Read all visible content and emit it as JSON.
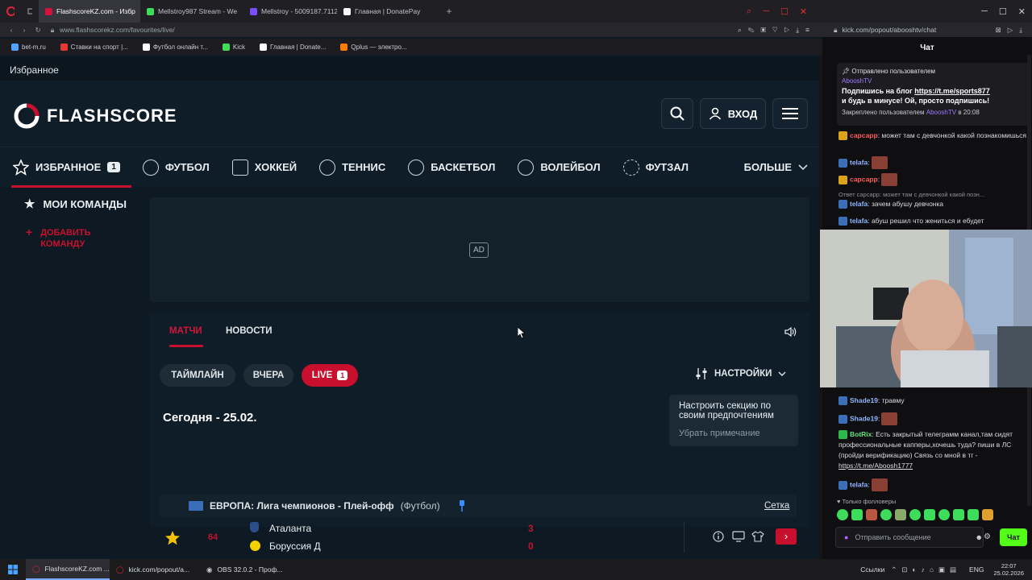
{
  "browser": {
    "tabs": [
      {
        "label": "FlashscoreKZ.com - Избр",
        "active": true,
        "color": "#d4143a"
      },
      {
        "label": "Mellstroy987 Stream - We",
        "active": false,
        "color": "#3ddc5a"
      },
      {
        "label": "Mellstroy - 5009187.7112",
        "active": false,
        "color": "#7c4dff"
      },
      {
        "label": "Главная | DonatePay",
        "active": false,
        "color": "#ffffff"
      }
    ],
    "url": "www.flashscorekz.com/favourites/live/",
    "bookmarks": [
      {
        "label": "bet-m.ru",
        "color": "#4fa3ff"
      },
      {
        "label": "Ставки на спорт |...",
        "color": "#e53935"
      },
      {
        "label": "Футбол онлайн т...",
        "color": "#ffffff"
      },
      {
        "label": "Kick",
        "color": "#3ddc5a"
      },
      {
        "label": "Главная | Donate...",
        "color": "#ffffff"
      },
      {
        "label": "Qplus — электро...",
        "color": "#ff7a00"
      }
    ]
  },
  "flashscore": {
    "favourites_title": "Избранное",
    "logo": "FLASHSCORE",
    "login_label": "ВХОД",
    "nav": [
      {
        "label": "ИЗБРАННОЕ",
        "badge": "1",
        "active": true
      },
      {
        "label": "ФУТБОЛ"
      },
      {
        "label": "ХОККЕЙ"
      },
      {
        "label": "ТЕННИС"
      },
      {
        "label": "БАСКЕТБОЛ"
      },
      {
        "label": "ВОЛЕЙБОЛ"
      },
      {
        "label": "ФУТЗАЛ"
      }
    ],
    "more_label": "БОЛЬШЕ",
    "my_teams": "МОИ КОМАНДЫ",
    "add_team": "ДОБАВИТЬ КОМАНДУ",
    "ad_label": "AD",
    "tabs": {
      "matches": "МАТЧИ",
      "news": "НОВОСТИ"
    },
    "filters": {
      "timeline": "ТАЙМЛАЙН",
      "yesterday": "ВЧЕРА",
      "live": "LIVE",
      "live_count": "1"
    },
    "settings_label": "НАСТРОЙКИ",
    "tooltip": {
      "text": "Настроить секцию по своим предпочтениям",
      "dismiss": "Убрать примечание"
    },
    "date_header": "Сегодня - 25.02.",
    "league": {
      "name": "ЕВРОПА: Лига чемпионов - Плей-офф",
      "sport": "(Футбол)",
      "bracket": "Сетка"
    },
    "match": {
      "minute": "64",
      "home": "Аталанта",
      "away": "Боруссия Д",
      "home_score": "3",
      "away_score": "0"
    }
  },
  "chat": {
    "url": "kick.com/popout/abooshtv/chat",
    "title": "Чат",
    "pinned_by_label": "Отправлено пользователем",
    "pinned_user": "AbooshTV",
    "pinned_text_1": "Подпишись на блог",
    "pinned_link": "https://t.me/sports877",
    "pinned_text_2": "и будь в минусе! Ой, просто подпишись!",
    "pinned_footer": "Закреплено пользователем",
    "pinned_footer_user": "AbooshTV",
    "pinned_time": "в 20:08",
    "messages_top": [
      {
        "name": "сарсарр",
        "text": ": может там с девчонкой какой познакомишься",
        "icon": "gold"
      },
      {
        "name": "telafa",
        "text": ":",
        "icon": "blue"
      },
      {
        "name": "сарсарр",
        "text": ":",
        "icon": "gold"
      },
      {
        "name": "",
        "text": "Ответ сарсарр: может там с девчонкой какой позн...",
        "icon": "reply"
      },
      {
        "name": "telafa",
        "text": ": зачем абушу девчонка",
        "icon": "blue"
      },
      {
        "name": "telafa",
        "text": ": абуш решил что жениться и ебудет",
        "icon": "blue"
      }
    ],
    "messages_bottom": [
      {
        "name": "Shade19",
        "text": ": травму",
        "icon": "blue"
      },
      {
        "name": "Shade19",
        "text": ":",
        "icon": "blue"
      },
      {
        "name": "BotRix",
        "text": ": Есть закрытый телеграмм канал,там сидят профессиональные капперы,хочешь туда? пиши в ЛС (пройди верификацию) Связь со мной в тг -",
        "link": "https://t.me/Aboosh1777",
        "icon": "green"
      },
      {
        "name": "telafa",
        "text": ":",
        "icon": "blue"
      }
    ],
    "followers_only": "Только фолловеры",
    "input_placeholder": "Отправить сообщение",
    "send_label": "Чат"
  },
  "taskbar": {
    "items": [
      {
        "label": "FlashscoreKZ.com ...",
        "active": true
      },
      {
        "label": "kick.com/popout/a...",
        "active": false
      },
      {
        "label": "OBS 32.0.2 - Проф...",
        "active": false
      }
    ],
    "links_label": "Ссылки",
    "lang": "ENG",
    "time": "22:07",
    "date": "25.02.2026"
  }
}
